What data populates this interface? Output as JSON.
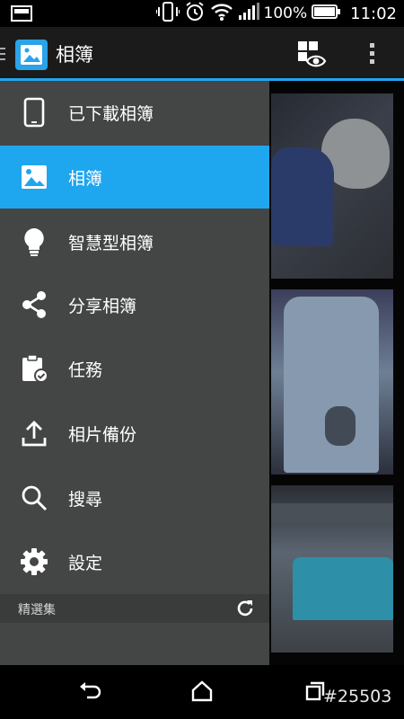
{
  "status_bar": {
    "battery_percent": "100%",
    "time": "11:02",
    "icons": [
      "image-notification-icon",
      "vibrate-icon",
      "alarm-icon",
      "wifi-icon",
      "signal-icon",
      "battery-icon"
    ]
  },
  "app_bar": {
    "title": "相簿",
    "icons": [
      "app-logo-icon",
      "view-mode-icon",
      "overflow-menu-icon"
    ]
  },
  "drawer": {
    "items": [
      {
        "label": "已下載相簿",
        "icon": "tablet-icon",
        "selected": false
      },
      {
        "label": "相簿",
        "icon": "image-icon",
        "selected": true
      },
      {
        "label": "智慧型相簿",
        "icon": "lightbulb-icon",
        "selected": false
      },
      {
        "label": "分享相簿",
        "icon": "share-icon",
        "selected": false
      },
      {
        "label": "任務",
        "icon": "clipboard-check-icon",
        "selected": false
      },
      {
        "label": "相片備份",
        "icon": "upload-icon",
        "selected": false
      },
      {
        "label": "搜尋",
        "icon": "search-icon",
        "selected": false
      },
      {
        "label": "設定",
        "icon": "gear-icon",
        "selected": false
      }
    ],
    "section": {
      "label": "精選集",
      "icon": "refresh-icon"
    }
  },
  "nav_bar": {
    "icons": [
      "back-icon",
      "home-icon",
      "recents-icon"
    ],
    "watermark": "#25503"
  },
  "colors": {
    "accent": "#1ea6ef",
    "drawer_bg": "#444545",
    "app_bar_bg": "#1b1b1b"
  }
}
